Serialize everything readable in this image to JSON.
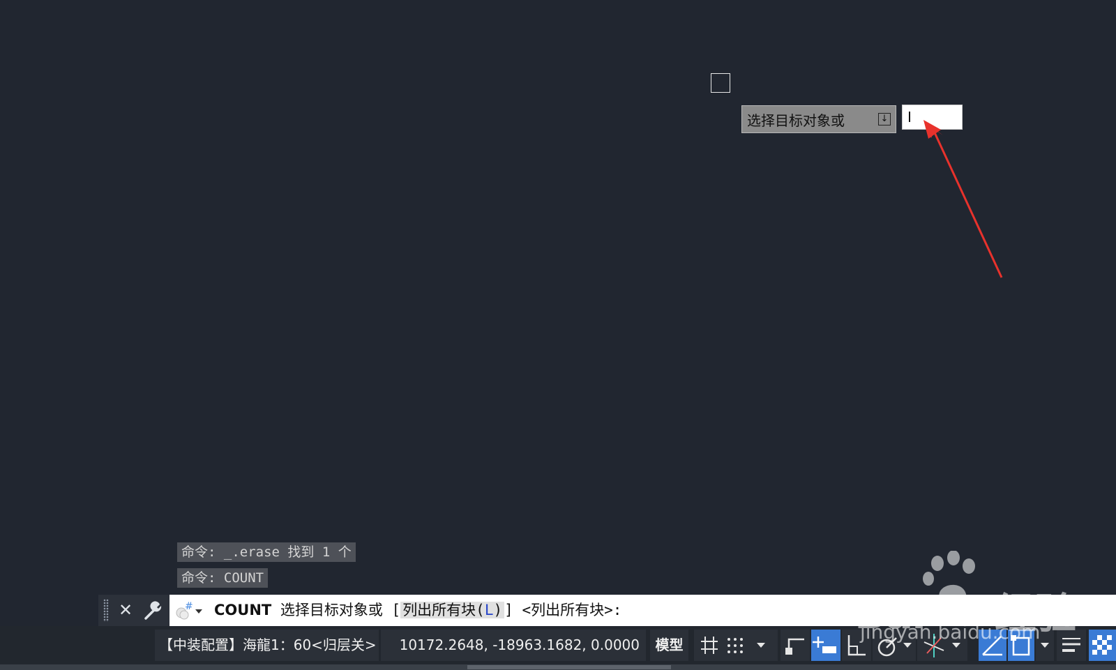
{
  "canvas": {
    "dynamic_prompt": "选择目标对象或",
    "dynamic_input_value": ""
  },
  "history": [
    "命令: _.erase 找到 1 个",
    "命令: COUNT"
  ],
  "command_line": {
    "command": "COUNT",
    "prompt": "选择目标对象或",
    "bracket_open": "[",
    "option_label_pre": "列出所有块(",
    "option_key": "L",
    "option_label_post": ")",
    "bracket_close": "]",
    "default": "<列出所有块>:"
  },
  "status_bar": {
    "scale_text": "【中装配置】海龍1：60<归层关>",
    "coordinates": "10172.2648, -18963.1682, 0.0000",
    "model_label": "模型",
    "icons": [
      "grid-icon",
      "snap-icon",
      "dropdown-icon",
      "infer-icon",
      "dynamic-input-icon",
      "ortho-icon",
      "polar-icon",
      "polar-dropdown-icon",
      "osnap-track-icon",
      "osnap-dropdown-icon",
      "osnap-icon",
      "osnap3d-icon",
      "osnap3d-dropdown-icon",
      "lineweight-icon",
      "transparency-icon"
    ]
  },
  "watermark": {
    "brand": "Bai",
    "brand_suffix": "经验",
    "url": "jingyan.baidu.com"
  },
  "colors": {
    "canvas_bg": "#212630",
    "statusbar_bg": "#2b3038",
    "active_icon": "#3a7bd5",
    "annotation_arrow": "#e8322c"
  }
}
